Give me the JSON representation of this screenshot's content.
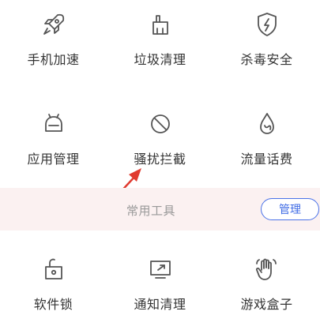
{
  "tools_top": [
    {
      "label": "手机加速",
      "icon": "rocket-icon"
    },
    {
      "label": "垃圾清理",
      "icon": "broom-icon"
    },
    {
      "label": "杀毒安全",
      "icon": "shield-lightning-icon"
    },
    {
      "label": "应用管理",
      "icon": "android-robot-icon"
    },
    {
      "label": "骚扰拦截",
      "icon": "block-icon"
    },
    {
      "label": "流量话费",
      "icon": "drop-icon"
    }
  ],
  "section": {
    "title": "常用工具",
    "manage_label": "管理"
  },
  "tools_common": [
    {
      "label": "软件锁",
      "icon": "unlocked-padlock-icon"
    },
    {
      "label": "通知清理",
      "icon": "notification-icon"
    },
    {
      "label": "游戏盒子",
      "icon": "hand-icon"
    }
  ],
  "colors": {
    "icon_stroke": "#555555",
    "label_text": "#333333",
    "section_band": "#fbf1f1",
    "accent_blue": "#3f6be5",
    "annotation_arrow": "#e03a2f"
  }
}
